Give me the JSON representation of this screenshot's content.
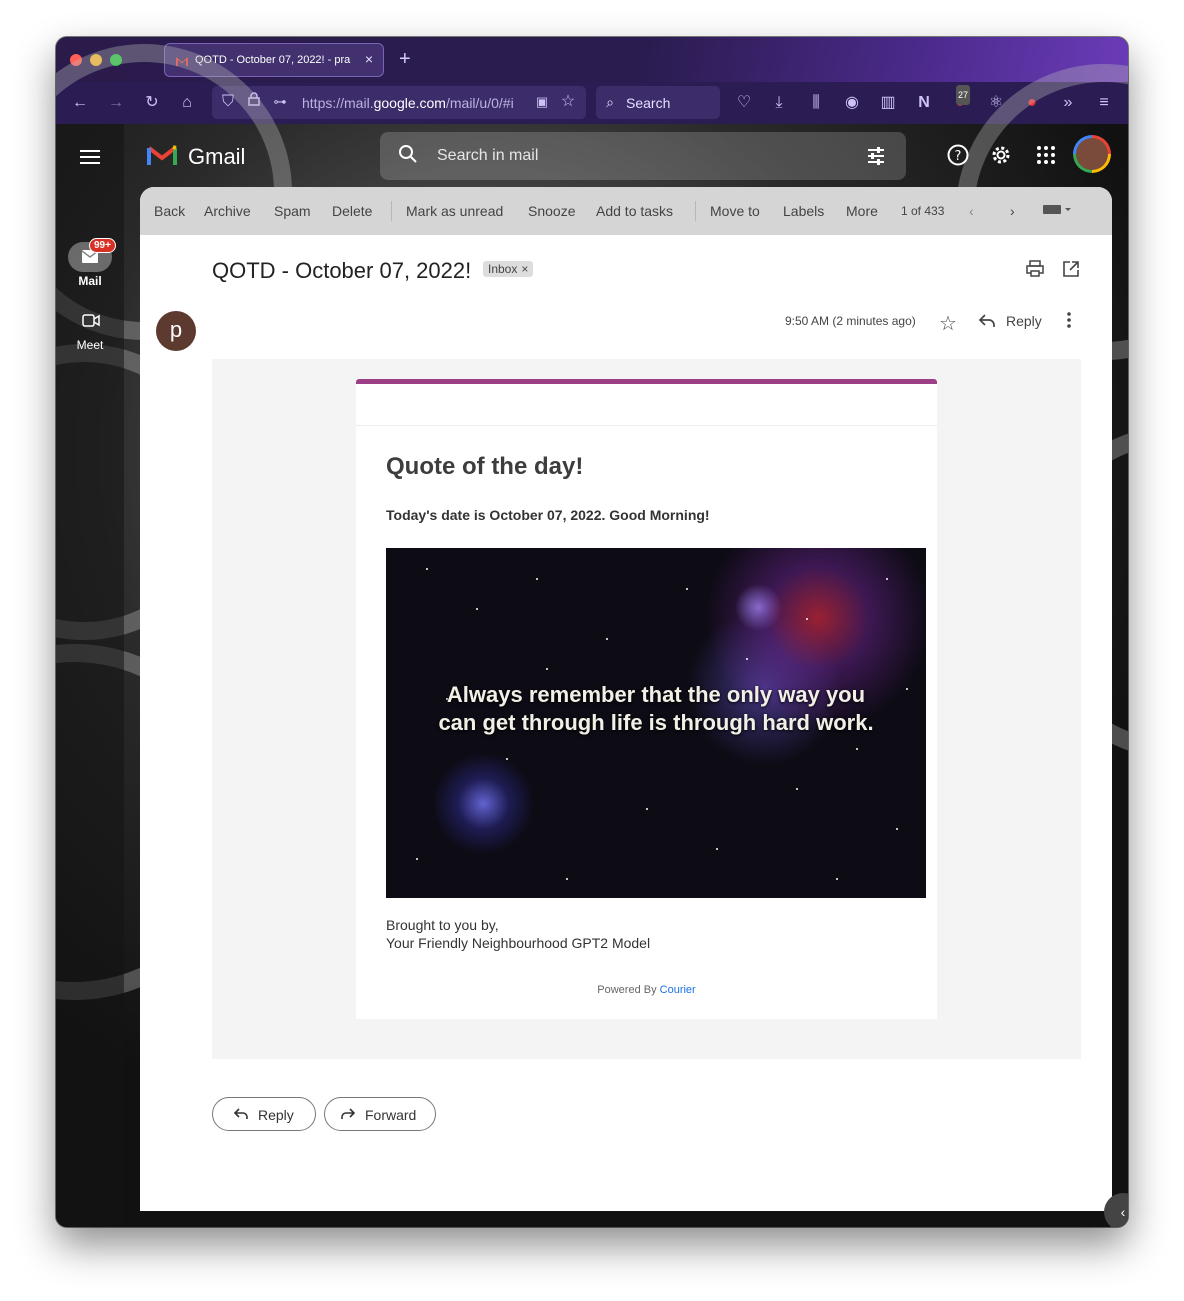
{
  "browser": {
    "tab_title": "QOTD - October 07, 2022! - pra",
    "tab_close": "×",
    "new_tab": "+",
    "url_prefix": "https://mail.",
    "url_domain": "google.com",
    "url_suffix": "/mail/u/0/#i",
    "search_label": "Search",
    "extension_badge": "27"
  },
  "gmail": {
    "app_name": "Gmail",
    "search_placeholder": "Search in mail",
    "rail": {
      "mail_label": "Mail",
      "mail_badge": "99+",
      "meet_label": "Meet"
    }
  },
  "toolbar": {
    "back": "Back",
    "archive": "Archive",
    "spam": "Spam",
    "delete": "Delete",
    "mark_unread": "Mark as unread",
    "snooze": "Snooze",
    "add_tasks": "Add to tasks",
    "move_to": "Move to",
    "labels": "Labels",
    "more": "More",
    "pagination": "1 of 433"
  },
  "message": {
    "subject": "QOTD - October 07, 2022!",
    "label_chip": "Inbox",
    "chip_remove": "×",
    "sender_initial": "p",
    "time": "9:50 AM (2 minutes ago)",
    "reply_label": "Reply"
  },
  "email": {
    "heading": "Quote of the day!",
    "date_line": "Today's date is October 07, 2022. Good Morning!",
    "quote": "Always remember that the only way you can get through life is through hard work.",
    "brought_line1": "Brought to you by,",
    "brought_line2": "Your Friendly Neighbourhood GPT2 Model",
    "powered_by": "Powered By",
    "powered_link": "Courier"
  },
  "actions": {
    "reply": "Reply",
    "forward": "Forward"
  },
  "colors": {
    "accent": "#9c3f87",
    "badge": "#d93025",
    "link": "#1a73e8"
  }
}
